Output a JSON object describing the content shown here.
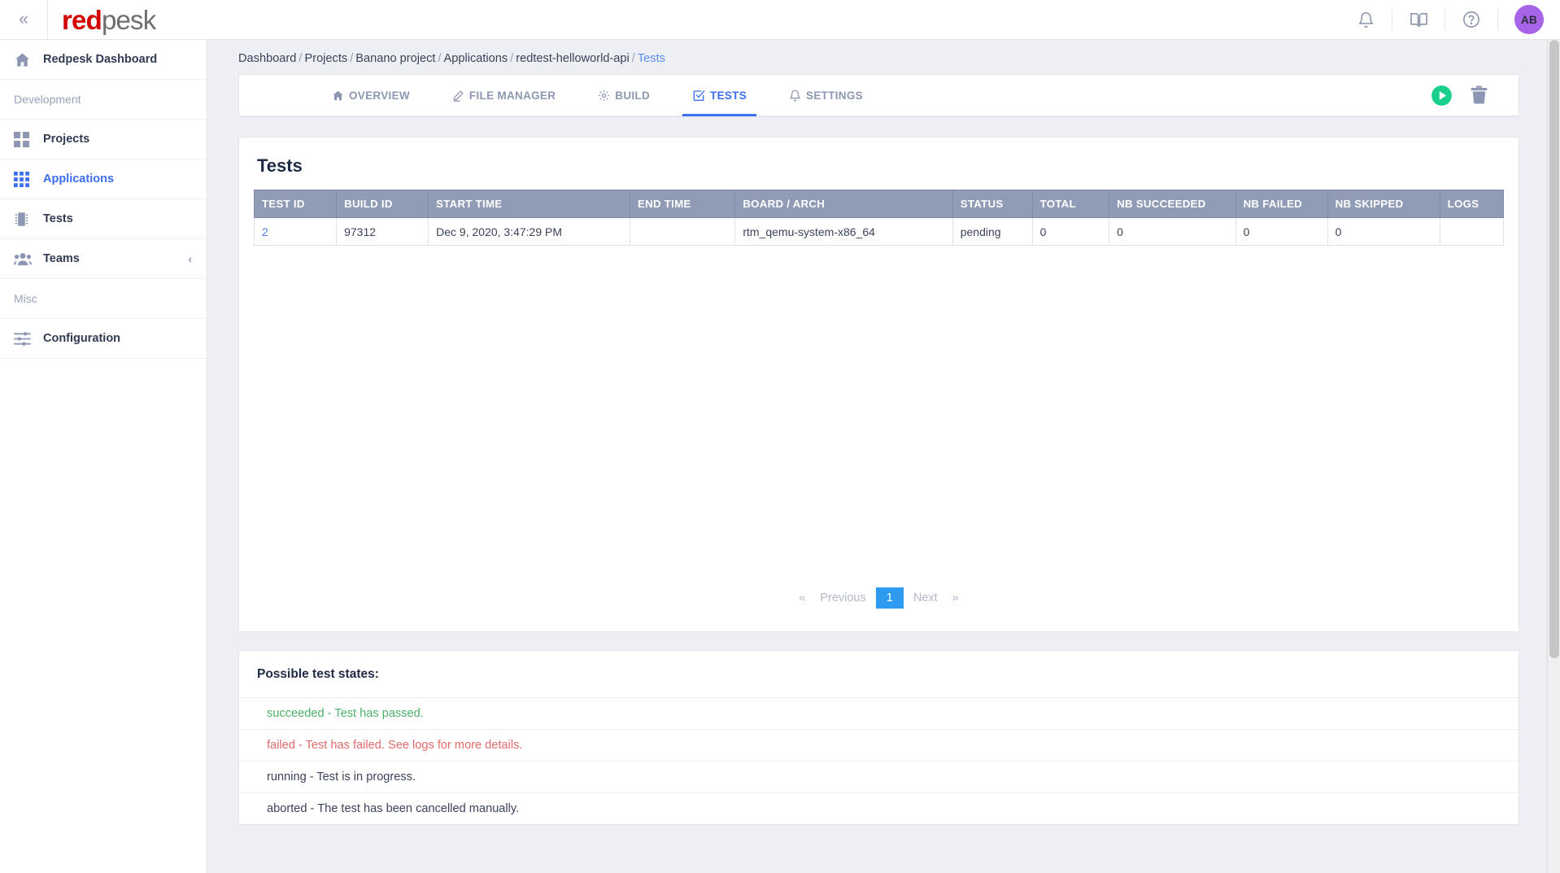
{
  "topbar": {
    "collapse_icon": "double-chevron-left-icon",
    "logo_red": "red",
    "logo_gray": "pesk",
    "icons": [
      {
        "name": "notifications-icon",
        "label": "bell-icon"
      },
      {
        "name": "docs-icon",
        "label": "book-icon"
      },
      {
        "name": "help-icon",
        "label": "question-circle-icon"
      }
    ],
    "avatar_initials": "AB",
    "avatar_color": "#a764e8"
  },
  "sidebar": {
    "dashboard": {
      "label": "Redpesk Dashboard",
      "icon": "home-icon"
    },
    "section_development": "Development",
    "section_misc": "Misc",
    "items": [
      {
        "label": "Projects",
        "icon": "grid-4-icon",
        "active": false
      },
      {
        "label": "Applications",
        "icon": "grid-9-icon",
        "active": true
      },
      {
        "label": "Tests",
        "icon": "chip-icon",
        "active": false
      },
      {
        "label": "Teams",
        "icon": "users-icon",
        "active": false,
        "chevron": "‹"
      }
    ],
    "misc_items": [
      {
        "label": "Configuration",
        "icon": "sliders-icon",
        "active": false
      }
    ]
  },
  "breadcrumb": {
    "items": [
      "Dashboard",
      "Projects",
      "Banano project",
      "Applications",
      "redtest-helloworld-api",
      "Tests"
    ],
    "separator": "/",
    "current_index": 5
  },
  "tabs": [
    {
      "label": "OVERVIEW",
      "icon": "home-icon",
      "active": false
    },
    {
      "label": "FILE MANAGER",
      "icon": "pencil-icon",
      "active": false
    },
    {
      "label": "BUILD",
      "icon": "gear-icon",
      "active": false
    },
    {
      "label": "TESTS",
      "icon": "checkbox-check-icon",
      "active": true
    },
    {
      "label": "SETTINGS",
      "icon": "bell-icon",
      "active": false
    }
  ],
  "tab_actions": [
    {
      "name": "run-tests-button",
      "icon": "play-circle-icon",
      "color": "#19d08a"
    },
    {
      "name": "delete-button",
      "icon": "trash-icon",
      "color": "#8d97b4"
    }
  ],
  "tests_card": {
    "title": "Tests",
    "columns": [
      "TEST ID",
      "BUILD ID",
      "START TIME",
      "END TIME",
      "BOARD / ARCH",
      "STATUS",
      "TOTAL",
      "NB SUCCEEDED",
      "NB FAILED",
      "NB SKIPPED",
      "LOGS"
    ],
    "rows": [
      {
        "test_id": "2",
        "build_id": "97312",
        "start_time": "Dec 9, 2020, 3:47:29 PM",
        "end_time": "",
        "board_arch": "rtm_qemu-system-x86_64",
        "status": "pending",
        "total": "0",
        "nb_succeeded": "0",
        "nb_failed": "0",
        "nb_skipped": "0",
        "logs": ""
      }
    ]
  },
  "pagination": {
    "first_chevron": "«",
    "previous": "Previous",
    "current_page": "1",
    "next": "Next",
    "last_chevron": "»"
  },
  "states_card": {
    "heading": "Possible test states:",
    "states": [
      {
        "text": "succeeded - Test has passed.",
        "color": "#4cb069"
      },
      {
        "text": "failed - Test has failed. See logs for more details.",
        "color": "#e16a6a"
      },
      {
        "text": "running - Test is in progress.",
        "color": "#3b4358"
      },
      {
        "text": "aborted - The test has been cancelled manually.",
        "color": "#3b4358"
      }
    ]
  }
}
